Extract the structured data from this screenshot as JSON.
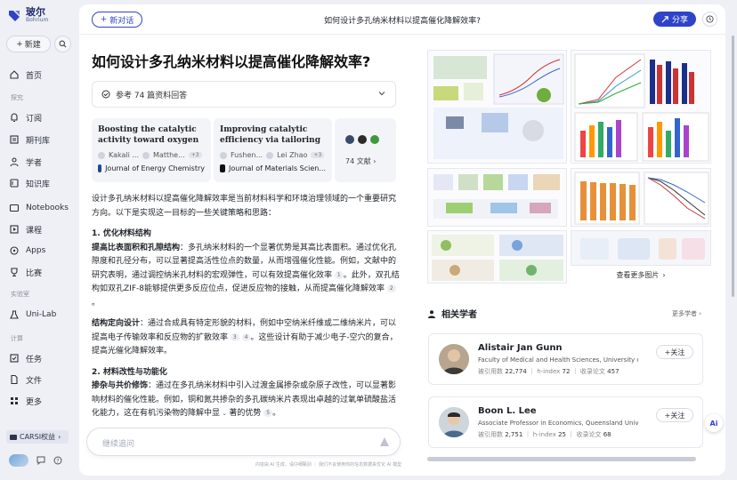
{
  "brand": {
    "name_cn": "玻尔",
    "name_en": "Bohrium",
    "accent": "#2f43c9"
  },
  "sidebar": {
    "new_label": "新建",
    "items": [
      {
        "label": "首页",
        "icon": "home-icon"
      },
      {
        "section": "探究"
      },
      {
        "label": "订阅",
        "icon": "bell-icon"
      },
      {
        "label": "期刊库",
        "icon": "journal-icon"
      },
      {
        "label": "学者",
        "icon": "scholar-icon"
      },
      {
        "label": "知识库",
        "icon": "knowledge-icon"
      },
      {
        "label": "Notebooks",
        "icon": "notebook-icon"
      },
      {
        "label": "课程",
        "icon": "course-icon"
      },
      {
        "label": "Apps",
        "icon": "apps-icon"
      },
      {
        "label": "比赛",
        "icon": "trophy-icon"
      },
      {
        "section": "实验室"
      },
      {
        "label": "Uni-Lab",
        "icon": "flask-icon"
      },
      {
        "section": "计算"
      },
      {
        "label": "任务",
        "icon": "task-icon"
      },
      {
        "label": "文件",
        "icon": "file-icon"
      },
      {
        "label": "更多",
        "icon": "grid-icon"
      }
    ],
    "carsi_label": "CARSI权益"
  },
  "topbar": {
    "new_chat": "新对话",
    "title": "如何设计多孔纳米材料以提高催化降解效率?",
    "share": "分享"
  },
  "question": "如何设计多孔纳米材料以提高催化降解效率?",
  "references": {
    "label": "参考 74 篇资料回答"
  },
  "papers": [
    {
      "title": "Boosting the catalytic activity toward oxygen reduction via...",
      "authors": [
        "Kakali ...",
        "Matthe..."
      ],
      "more": "+3",
      "journal": "Journal of Energy Chemistry"
    },
    {
      "title": "Improving catalytic efficiency via tailoring macroscopic...",
      "authors": [
        "Fushen...",
        "Lei Zhao"
      ],
      "more": "+3",
      "journal": "Journal of Materials Scien..."
    }
  ],
  "more_papers": "74 文献",
  "article": {
    "intro": "设计多孔纳米材料以提高催化降解效率是当前材料科学和环境治理领域的一个重要研究方向。以下是实现这一目标的一些关键策略和思路：",
    "s1_title": "1. 优化材料结构",
    "s1_p1_bold": "提高比表面积和孔隙结构",
    "s1_p1": "：多孔纳米材料的一个显著优势是其高比表面积。通过优化孔隙度和孔径分布，可以显著提高活性位点的数量，从而增强催化性能。例如，文献中的研究表明，通过调控纳米孔材料的宏观弹性，可以有效提高催化效率",
    "s1_p1_cite": "1",
    "s1_p1b": "。此外，双孔结构如双孔ZIF-8能够提供更多反应位点，促进反应物的接触，从而提高催化降解效率",
    "s1_p1b_cite": "2",
    "s1_p2_bold": "结构定向设计",
    "s1_p2": "：通过合成具有特定形貌的材料，例如中空纳米纤维或二维纳米片，可以提高电子传输效率和反应物的扩散效率",
    "s1_p2_cite1": "3",
    "s1_p2_cite2": "4",
    "s1_p2b": "。这些设计有助于减少电子-空穴的复合，提高光催化降解效率。",
    "s2_title": "2. 材料改性与功能化",
    "s2_p1_bold": "掺杂与共价修饰",
    "s2_p1": "：通过在多孔纳米材料中引入过渡金属掺杂或杂原子改性，可以显著影响材料的催化性能。例如，铜和氮共掺杂的多孔碳纳米片表现出卓越的过氧单硫酸盐活化能力，这在有机污染物的降解中显",
    "s2_p1b": "著的优势",
    "s2_p1_cite": "5"
  },
  "input": {
    "placeholder": "继续追问"
  },
  "footer_note": "内容由 AI 生成，请仔细甄别 ｜ 我们不会使用你的信息数据来优化 AI 模型",
  "images": {
    "more_label": "查看更多图片"
  },
  "scholars": {
    "heading": "相关学者",
    "more": "更多学者",
    "follow": "关注",
    "items": [
      {
        "name": "Alistair Jan Gunn",
        "affiliation": "Faculty of Medical and Health Sciences, University of...",
        "citations_label": "被引用数",
        "citations": "22,774",
        "hindex_label": "h-index",
        "hindex": "72",
        "papers_label": "收录论文",
        "papers": "457"
      },
      {
        "name": "Boon L. Lee",
        "affiliation": "Associate Professor in Economics, Queensland University ...",
        "citations_label": "被引用数",
        "citations": "2,751",
        "hindex_label": "h-index",
        "hindex": "25",
        "papers_label": "收录论文",
        "papers": "68"
      }
    ]
  },
  "fab": "Ai"
}
